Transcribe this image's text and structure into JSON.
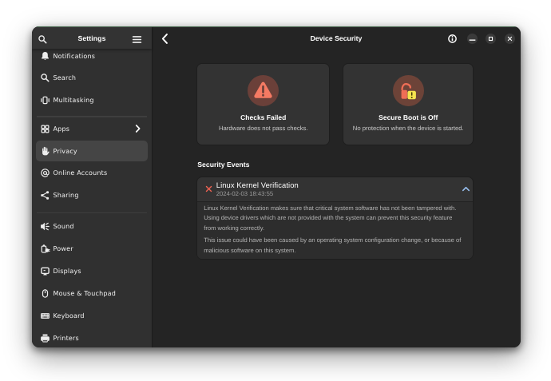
{
  "window": {
    "sidebar": {
      "title": "Settings",
      "items": [
        {
          "label": "Notifications",
          "icon": "bell"
        },
        {
          "label": "Search",
          "icon": "magnifier"
        },
        {
          "label": "Multitasking",
          "icon": "multitasking"
        },
        {
          "separator": true
        },
        {
          "label": "Apps",
          "icon": "apps",
          "chevron": true
        },
        {
          "label": "Privacy",
          "icon": "hand",
          "selected": true
        },
        {
          "label": "Online Accounts",
          "icon": "at"
        },
        {
          "label": "Sharing",
          "icon": "share"
        },
        {
          "separator": true
        },
        {
          "label": "Sound",
          "icon": "speaker"
        },
        {
          "label": "Power",
          "icon": "battery"
        },
        {
          "label": "Displays",
          "icon": "monitor"
        },
        {
          "label": "Mouse & Touchpad",
          "icon": "mouse"
        },
        {
          "label": "Keyboard",
          "icon": "keyboard"
        },
        {
          "label": "Printers",
          "icon": "printer"
        }
      ]
    },
    "header": {
      "title": "Device Security"
    },
    "status_cards": [
      {
        "title": "Checks Failed",
        "subtitle": "Hardware does not pass checks.",
        "icon": "warning-triangle"
      },
      {
        "title": "Secure Boot is Off",
        "subtitle": "No protection when the device is started.",
        "icon": "lock-open-warning"
      }
    ],
    "security_events": {
      "heading": "Security Events",
      "event": {
        "title": "Linux Kernel Verification",
        "timestamp": "2024-02-03 18:43:55",
        "paragraphs": [
          "Linux Kernel Verification makes sure that critical system software has not been tampered with. Using device drivers which are not provided with the system can prevent this security feature from working correctly.",
          "This issue could have been caused by an operating system configuration change, or because of malicious software on this system."
        ]
      }
    }
  },
  "colors": {
    "accent_blue": "#99c1f1",
    "error_red": "#f06252",
    "warning_salmon": "#f57a63",
    "lock_orange": "#ef6e56",
    "badge_yellow": "#f6e34f"
  }
}
